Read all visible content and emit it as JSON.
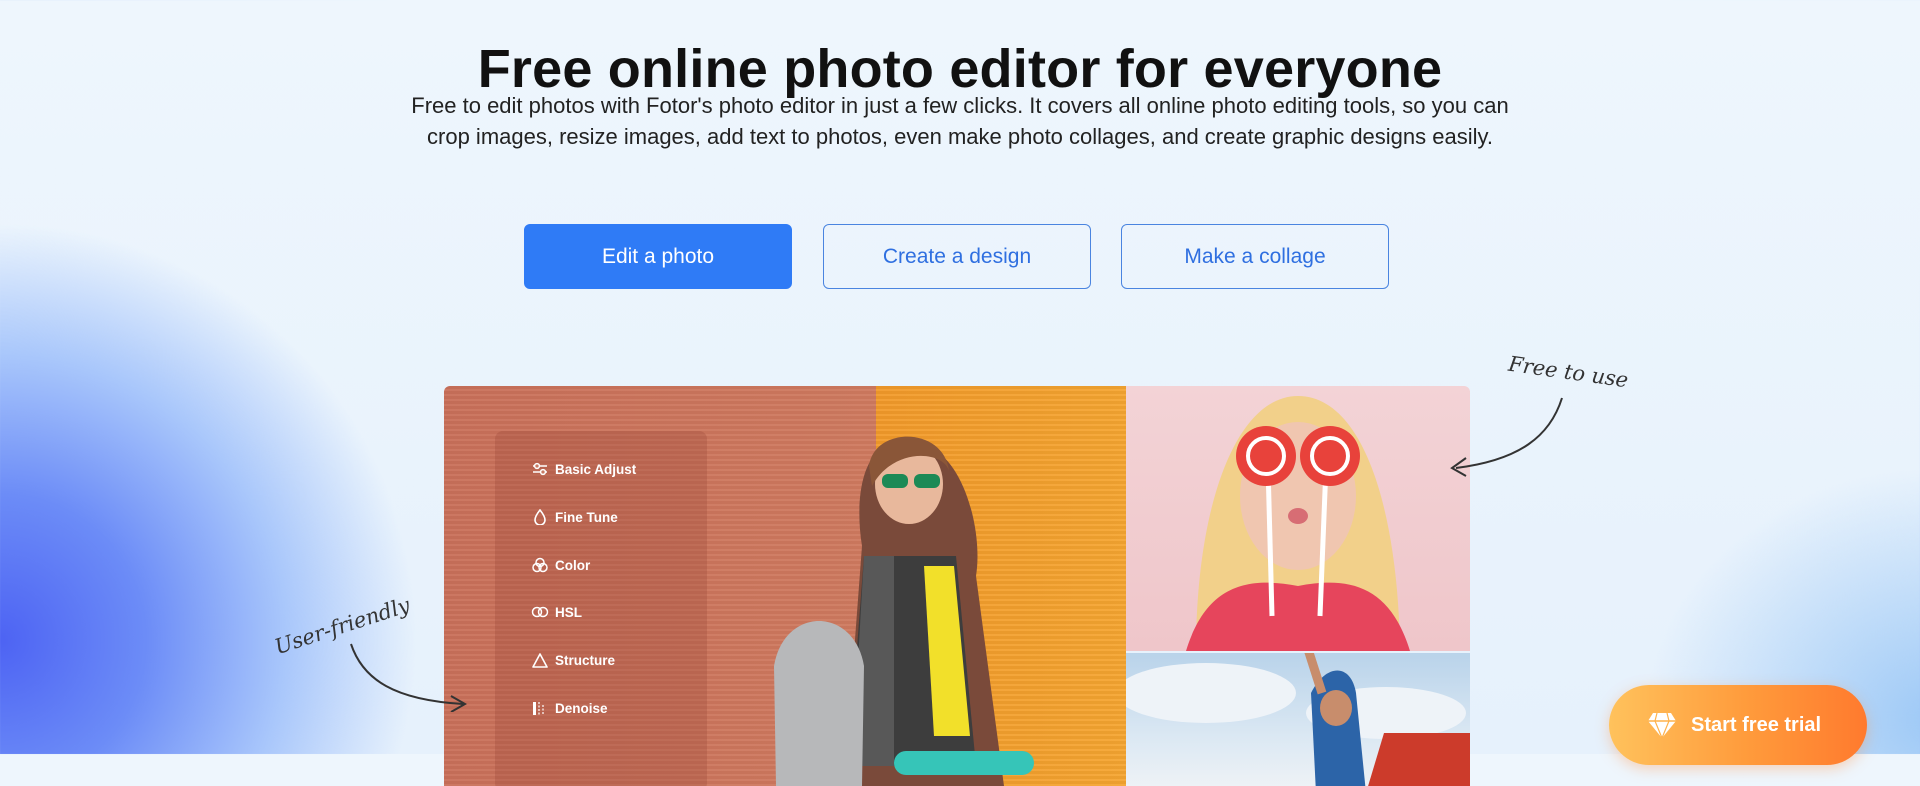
{
  "hero": {
    "title": "Free online photo editor for everyone",
    "description": "Free to edit photos with Fotor's photo editor in just a few clicks. It covers all online photo editing tools, so you can crop images, resize images, add text to photos, even make photo collages, and create graphic designs easily."
  },
  "actions": {
    "edit_label": "Edit a photo",
    "design_label": "Create a design",
    "collage_label": "Make a collage"
  },
  "editor_tools": [
    {
      "label": "Basic Adjust",
      "icon": "sliders-icon"
    },
    {
      "label": "Fine Tune",
      "icon": "droplet-icon"
    },
    {
      "label": "Color",
      "icon": "color-circles-icon"
    },
    {
      "label": "HSL",
      "icon": "hsl-rings-icon"
    },
    {
      "label": "Structure",
      "icon": "triangle-icon"
    },
    {
      "label": "Denoise",
      "icon": "denoise-icon"
    }
  ],
  "annotations": {
    "free_to_use": "Free to use",
    "user_friendly": "User-friendly"
  },
  "cta": {
    "trial_label": "Start free trial"
  },
  "colors": {
    "primary": "#2f7bf6",
    "trial_start": "#ffc25c",
    "trial_end": "#ff7a2e"
  }
}
